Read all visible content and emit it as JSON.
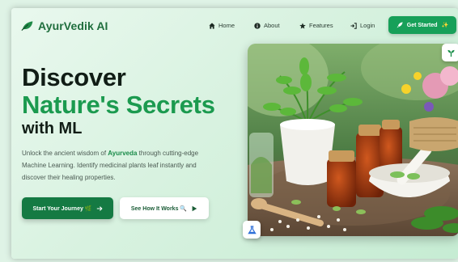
{
  "brand": {
    "name": "AyurVedik AI",
    "icon": "leaf-icon",
    "color": "#1f6e3d"
  },
  "nav": {
    "items": [
      {
        "label": "Home",
        "icon": "home-icon"
      },
      {
        "label": "About",
        "icon": "info-icon"
      },
      {
        "label": "Features",
        "icon": "star-icon"
      },
      {
        "label": "Login",
        "icon": "login-icon"
      }
    ],
    "cta": {
      "label": "Get Started",
      "icon": "rocket-icon",
      "suffix": "✨"
    }
  },
  "hero": {
    "line1": "Discover",
    "line2": "Nature's Secrets",
    "line3": "with ML",
    "description": {
      "before": "Unlock the ancient wisdom of ",
      "highlight": "Ayurveda",
      "after": " through cutting-edge Machine Learning. Identify medicinal plants leaf instantly and discover their healing properties."
    },
    "primary_button": {
      "label": "Start Your Journey 🌿",
      "icon": "arrow-right-icon"
    },
    "secondary_button": {
      "label": "See How It Works 🔍",
      "icon": "play-icon"
    },
    "image_alt": "herbal-remedies-photo"
  },
  "colors": {
    "accent": "#17a059",
    "accent_dark": "#157a43",
    "heading": "#111d16",
    "heading_green": "#1b9a4f"
  }
}
